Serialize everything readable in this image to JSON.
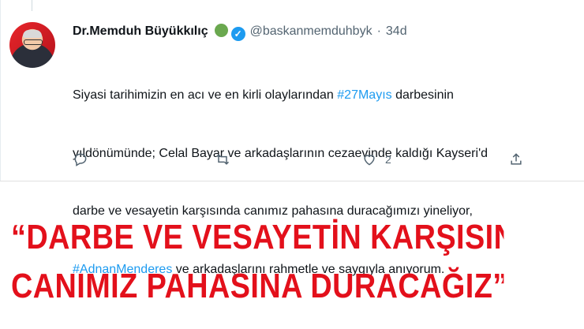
{
  "tweet": {
    "author_name": "Dr.Memduh Büyükkılıç",
    "handle": "@baskanmemduhbyk",
    "separator": "·",
    "time": "34d",
    "lines": [
      {
        "pre": "Siyasi tarihimizin en acı ve en kirli olaylarından ",
        "tag": "#27Mayıs",
        "post": " darbesinin"
      },
      {
        "pre": "yıldönümünde; Celal Bayar ve arkadaşlarının cezaevinde kaldığı Kayseri'd",
        "tag": "",
        "post": ""
      },
      {
        "pre": "darbe ve vesayetin karşısında canımız pahasına duracağımızı yineliyor,",
        "tag": "",
        "post": ""
      },
      {
        "pre": "",
        "tag": "#AdnanMenderes",
        "post": " ve arkadaşlarını rahmetle ve saygıyla anıyorum."
      }
    ],
    "actions": {
      "reply_count": "",
      "retweet_count": "",
      "like_count": "2",
      "share_count": ""
    }
  },
  "headline": {
    "line1": "“DARBE VE VESAYETİN KARŞISINDA",
    "line2": "CANIMIZ PAHASINA DURACAĞIZ”"
  },
  "colors": {
    "hashtag": "#1d9bf0",
    "verified": "#1d9bf0",
    "headline": "#e3101b",
    "muted": "#536471"
  },
  "icons": [
    "reply-icon",
    "retweet-icon",
    "like-icon",
    "share-icon",
    "verified-icon"
  ]
}
